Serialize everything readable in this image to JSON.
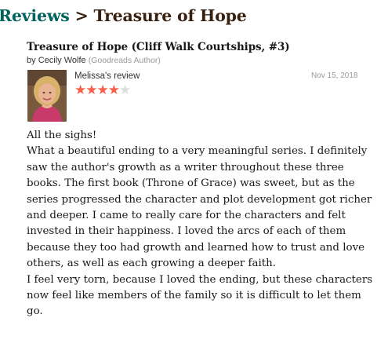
{
  "breadcrumb": {
    "parent": "Reviews",
    "separator": ">",
    "current": "Treasure of Hope"
  },
  "book": {
    "title": "Treasure of Hope (Cliff Walk Courtships, #3)",
    "by_prefix": "by",
    "author": "Cecily Wolfe",
    "author_role": "(Goodreads Author)"
  },
  "review": {
    "reviewer_name": "Melissa's",
    "reviewer_suffix": "review",
    "date": "Nov 15, 2018",
    "rating": 4,
    "rating_max": 5,
    "paragraphs": [
      "All the sighs!",
      "What a beautiful ending to a very meaningful series. I definitely saw the author's growth as a writer throughout these three books. The first book (Throne of Grace) was sweet, but as the series progressed the character and plot development got richer and deeper. I came to really care for the characters and felt invested in their happiness. I loved the arcs of each of them because they too had growth and learned how to trust and love others, as well as each growing a deeper faith.",
      "I feel very torn, because I loved the ending, but these characters now feel like members of the family so it is difficult to let them go."
    ]
  },
  "colors": {
    "star_filled": "#fa604a",
    "star_empty": "#dddddd",
    "link_green": "#00635d",
    "heading_brown": "#382110"
  }
}
